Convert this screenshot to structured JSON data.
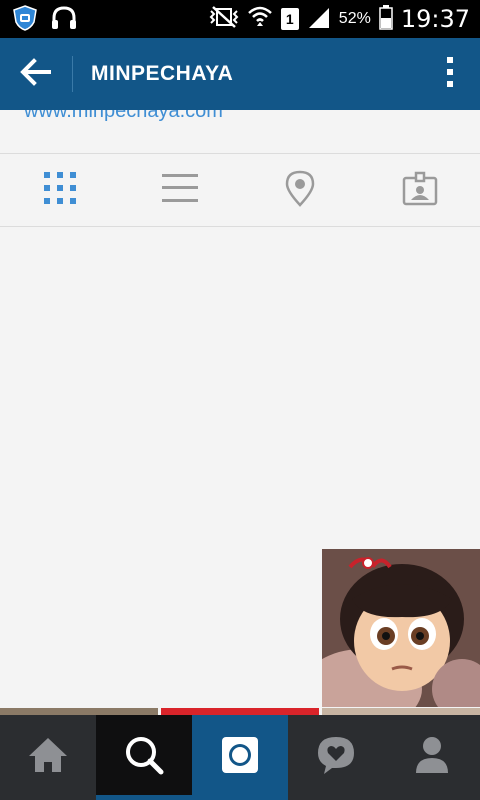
{
  "status_bar": {
    "battery": "52%",
    "time": "19:37",
    "sim": "1",
    "icons": [
      "shield-icon",
      "headphones-icon",
      "no-sim-vibrate-icon",
      "wifi-icon",
      "signal-icon",
      "battery-icon"
    ]
  },
  "app_bar": {
    "title": "MINPECHAYA",
    "back_icon": "back-arrow-icon",
    "overflow_icon": "overflow-menu-icon",
    "color": "#125688"
  },
  "profile": {
    "website": "www.minpechaya.com"
  },
  "tabs": [
    {
      "name": "grid-view",
      "icon": "grid-icon",
      "active": true
    },
    {
      "name": "list-view",
      "icon": "list-icon",
      "active": false
    },
    {
      "name": "photo-map",
      "icon": "location-pin-icon",
      "active": false
    },
    {
      "name": "photos-of-you",
      "icon": "tagged-person-icon",
      "active": false
    }
  ],
  "bottom_nav": [
    {
      "name": "home",
      "icon": "home-icon",
      "active": false
    },
    {
      "name": "search",
      "icon": "search-icon",
      "active": true
    },
    {
      "name": "camera",
      "icon": "camera-icon",
      "active": false
    },
    {
      "name": "activity",
      "icon": "heart-bubble-icon",
      "active": false
    },
    {
      "name": "profile",
      "icon": "profile-icon",
      "active": false
    }
  ],
  "colors": {
    "accent": "#3f8ed4",
    "nav_background": "#2b2d30",
    "nav_active": "#0f0f10"
  }
}
